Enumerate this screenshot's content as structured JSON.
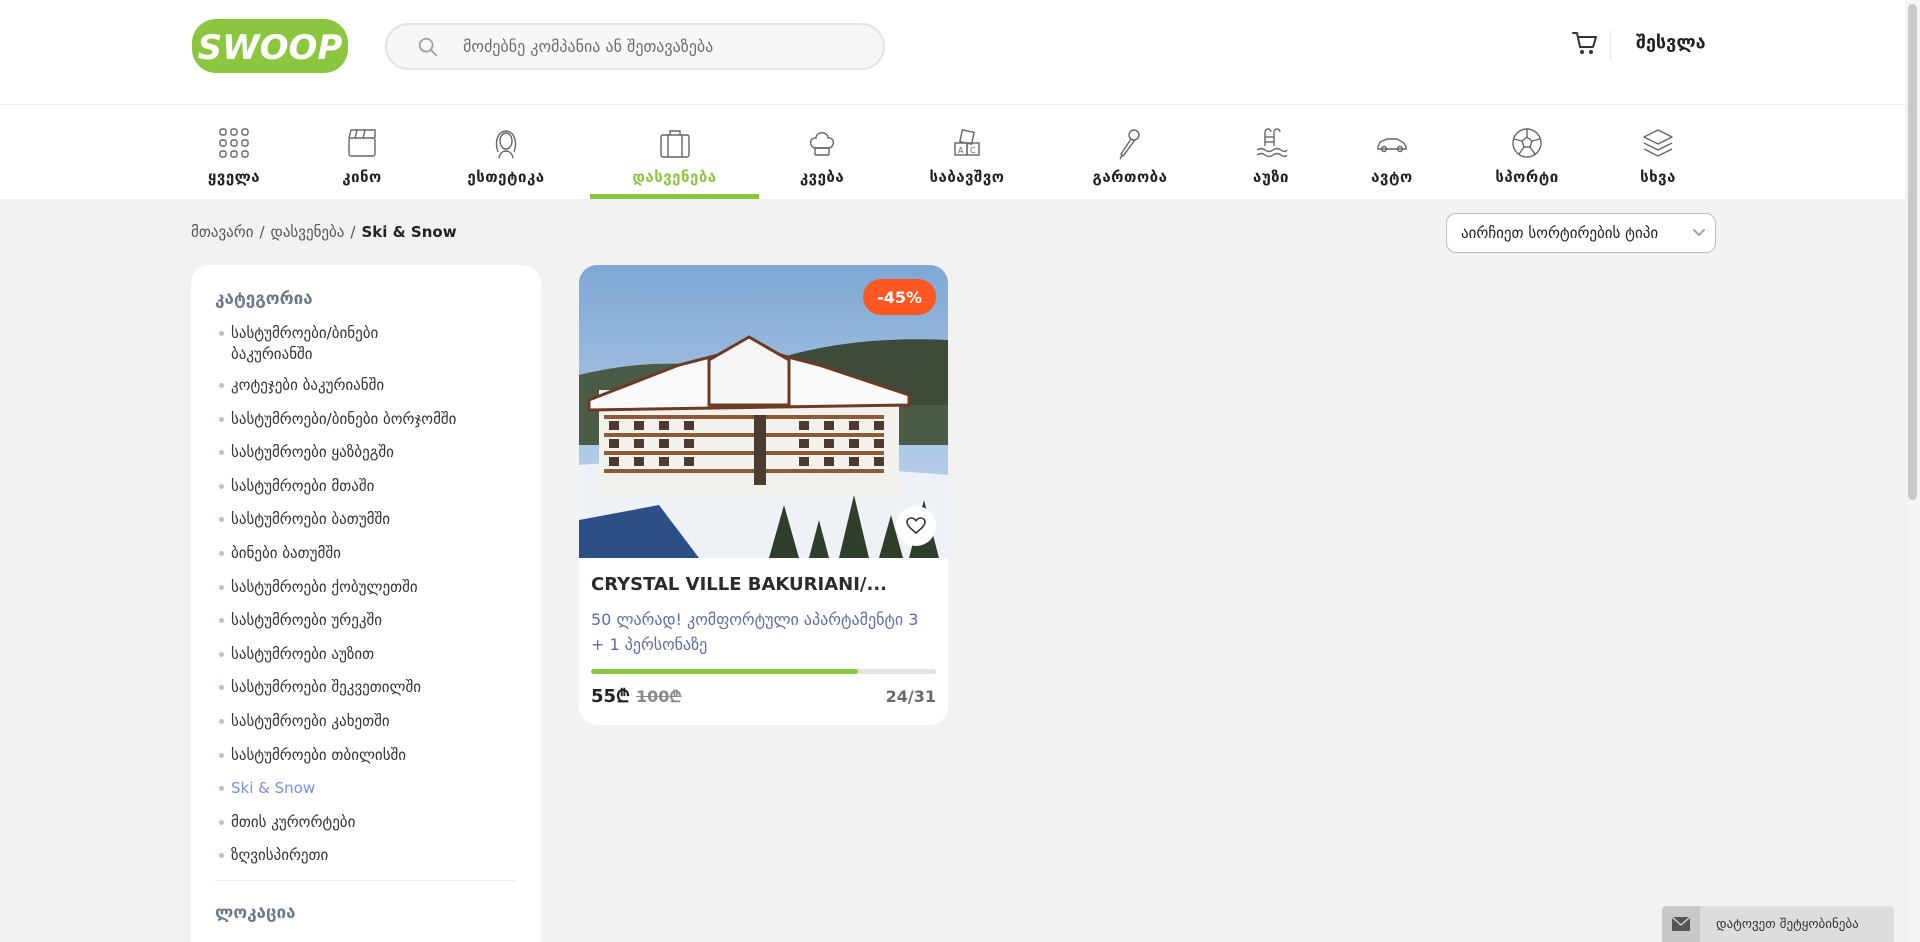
{
  "header": {
    "logo_text": "SWOOP",
    "search_placeholder": "მოძებნე კომპანია ან შეთავაზება",
    "login_label": "შესვლა"
  },
  "categories": [
    {
      "label": "ყველა",
      "icon": "grid-icon"
    },
    {
      "label": "კინო",
      "icon": "clapperboard-icon"
    },
    {
      "label": "ესთეტიკა",
      "icon": "beauty-face-icon"
    },
    {
      "label": "დასვენება",
      "icon": "suitcase-icon",
      "active": true
    },
    {
      "label": "კვება",
      "icon": "chef-hat-icon"
    },
    {
      "label": "საბავშვო",
      "icon": "toy-blocks-icon"
    },
    {
      "label": "გართობა",
      "icon": "microphone-icon"
    },
    {
      "label": "აუზი",
      "icon": "pool-icon"
    },
    {
      "label": "ავტო",
      "icon": "car-icon"
    },
    {
      "label": "სპორტი",
      "icon": "soccer-ball-icon"
    },
    {
      "label": "სხვა",
      "icon": "layers-icon"
    }
  ],
  "breadcrumb": {
    "home": "მთავარი",
    "section": "დასვენება",
    "current": "Ski & Snow",
    "sep1": "/",
    "sep2": "/"
  },
  "sort": {
    "label": "აირჩიეთ სორტირების ტიპი"
  },
  "sidebar": {
    "category_title": "კატეგორია",
    "items": [
      "სასტუმროები/ბინები ბაკურიანში",
      "კოტეჯები ბაკურიანში",
      "სასტუმროები/ბინები ბორჯომში",
      "სასტუმროები ყაზბეგში",
      "სასტუმროები მთაში",
      "სასტუმროები ბათუმში",
      "ბინები ბათუმში",
      "სასტუმროები ქობულეთში",
      "სასტუმროები ურეკში",
      "სასტუმროები აუზით",
      "სასტუმროები შეკვეთილში",
      "სასტუმროები კახეთში",
      "სასტუმროები თბილისში",
      "Ski & Snow",
      "მთის კურორტები",
      "ზღვისპირეთი"
    ],
    "active_item": "Ski & Snow",
    "location_title": "ლოკაცია"
  },
  "offer": {
    "discount": "-45%",
    "title": "CRYSTAL VILLE BAKURIANI/...",
    "description": "50 ლარად! კომფორტული აპარტამენტი 3 + 1 პერსონაზე",
    "price": "55₾",
    "old_price": "100₾",
    "sold_count": "24/31",
    "progress_fraction": 0.774
  },
  "message_widget": {
    "label": "დატოვეთ შეტყობინება"
  },
  "colors": {
    "brand_green": "#8cc63f",
    "discount_orange": "#fe5722",
    "active_link": "#7b8fe0"
  }
}
